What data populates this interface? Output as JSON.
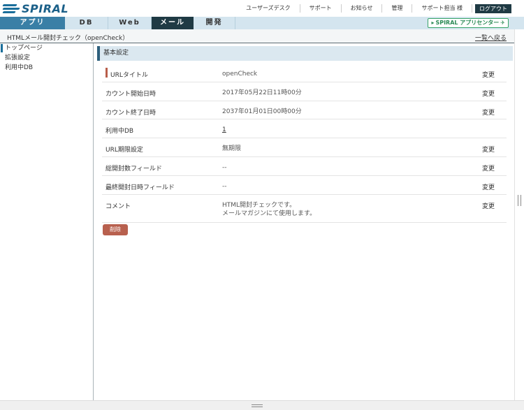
{
  "header": {
    "logo_text": "SPIRAL",
    "links": [
      "ユーザーズデスク",
      "サポート",
      "お知らせ",
      "管理",
      "サポート担当 様"
    ],
    "logout_label": "ログアウト"
  },
  "nav": {
    "tabs": [
      "アプリ",
      "DB",
      "Web",
      "メール",
      "開発"
    ],
    "active_tab": "メール",
    "app_center_label": "SPIRAL アプリセンター"
  },
  "breadcrumb": {
    "title": "HTMLメール開封チェック（openCheck）",
    "back_label": "一覧へ戻る"
  },
  "sidebar": {
    "items": [
      "トップページ",
      "拡張設定",
      "利用中DB"
    ]
  },
  "section": {
    "title": "基本設定"
  },
  "settings": {
    "rows": [
      {
        "label": "URLタイトル",
        "value": "openCheck",
        "action": "変更"
      },
      {
        "label": "カウント開始日時",
        "value": "2017年05月22日11時00分",
        "action": "変更"
      },
      {
        "label": "カウント終了日時",
        "value": "2037年01月01日00時00分",
        "action": "変更"
      },
      {
        "label": "利用中DB",
        "value": "1",
        "action": ""
      },
      {
        "label": "URL期限設定",
        "value": "無期限",
        "action": "変更"
      },
      {
        "label": "総開封数フィールド",
        "value": "--",
        "action": "変更"
      },
      {
        "label": "最終開封日時フィールド",
        "value": "--",
        "action": "変更"
      },
      {
        "label": "コメント",
        "value": "HTML開封チェックです。",
        "value2": "メールマガジンにて使用します。",
        "action": "変更"
      }
    ]
  },
  "actions": {
    "delete_label": "削除"
  },
  "colors": {
    "primary": "#1f3a44",
    "accent_blue": "#3a7fa6",
    "delete": "#b8604e",
    "app_center_green": "#2a8a55"
  }
}
